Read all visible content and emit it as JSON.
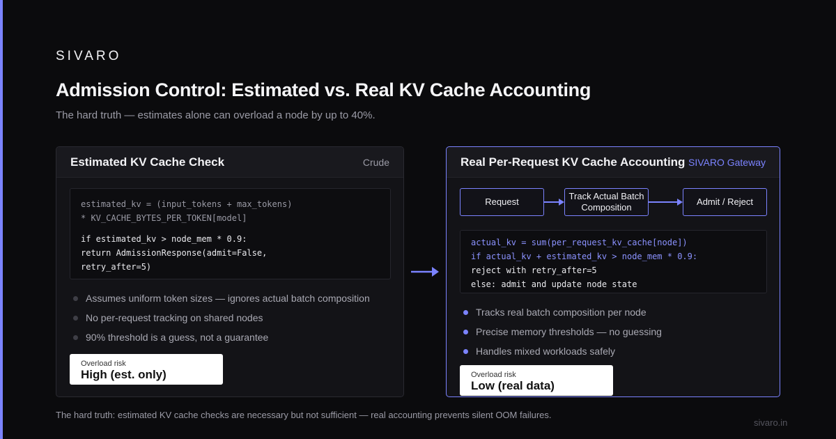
{
  "brand": "SIVARO",
  "title": "Admission Control: Estimated vs. Real KV Cache Accounting",
  "subtitle": "The hard truth — estimates alone can overload a node by up to 40%.",
  "left_panel": {
    "title": "Estimated KV Cache Check",
    "tag": "Crude",
    "code": [
      "estimated_kv = (input_tokens + max_tokens)",
      "* KV_CACHE_BYTES_PER_TOKEN[model]",
      "if estimated_kv > node_mem * 0.9:",
      "return AdmissionResponse(admit=False,",
      "retry_after=5)"
    ],
    "bullets": [
      "Assumes uniform token sizes — ignores actual batch composition",
      "No per-request tracking on shared nodes",
      "90% threshold is a guess, not a guarantee"
    ],
    "risk_label": "Overload risk",
    "risk_value": "High (est. only)"
  },
  "right_panel": {
    "title": "Real Per-Request KV Cache Accounting",
    "tag": "SIVARO Gateway",
    "flow": [
      "Request",
      "Track Actual Batch Composition",
      "Admit / Reject"
    ],
    "code": [
      "actual_kv = sum(per_request_kv_cache[node])",
      "if actual_kv + estimated_kv > node_mem * 0.9:",
      "reject with retry_after=5",
      "else: admit and update node state"
    ],
    "bullets": [
      "Tracks real batch composition per node",
      "Precise memory thresholds — no guessing",
      "Handles mixed workloads safely"
    ],
    "risk_label": "Overload risk",
    "risk_value": "Low (real data)"
  },
  "footer": "The hard truth: estimated KV cache checks are necessary but not sufficient — real accounting prevents silent OOM failures.",
  "site": "sivaro.in",
  "colors": {
    "background": "#0b0b0d",
    "accent": "#7b83ff",
    "panel": "#131317",
    "risk_card": "#ffffff"
  },
  "icons": [
    "arrow-right-icon",
    "bullet-dot-icon"
  ]
}
